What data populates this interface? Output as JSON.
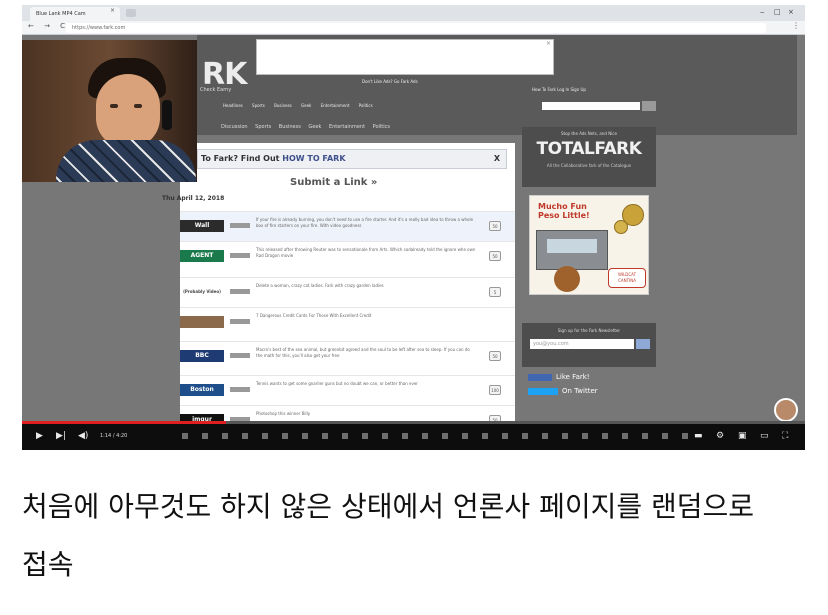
{
  "browser": {
    "tab_title": "Blue Lank MP4 Cam",
    "tab_close": "×",
    "url": "https://www.fark.com",
    "nav_buttons": "← → C ⌂",
    "window_controls": [
      "‒",
      "□",
      "×"
    ]
  },
  "site": {
    "logo": "RK",
    "tagline": "Check Earny",
    "nav_links": "Don't Like Ads? Go Fark Ads",
    "user_links": "How To Fark   Log In   Sign Up",
    "top_nav": "Headlines   Sports   Business   Geek   Entertainment   Politics",
    "category_nav": "Discussion   Sports   Business   Geek   Entertainment   Politics",
    "howto_text": "To Fark? Find Out ",
    "howto_link": "HOW TO FARK",
    "howto_close": "X",
    "submit": "Submit a Link »",
    "date": "Thu April 12, 2018",
    "links": [
      {
        "source": "Wall",
        "text": "If your fire is already burning, you don't need to use a fire starter. And it's a really bad idea to throw a whole box of fire starters on your fire. With video goodness",
        "comments": "50",
        "color": "#2b2b2b"
      },
      {
        "source": "AGENT",
        "text": "This released after throwing Reuter was to sensationale from Arts. Which sadalready told the ignore whe own Rad Dragon movie",
        "comments": "50",
        "color": "#1a7a4c"
      },
      {
        "source": "(Probably Video)",
        "text": "Delete a woman, crazy cat ladies. Fark with crazy garden ladies",
        "comments": "5",
        "color": "#333333"
      },
      {
        "source": "",
        "text": "7 Dangerous Credit Cards For Those With Excellent Credit",
        "comments": "",
        "color": "#8a6a4a"
      },
      {
        "source": "BBC",
        "text": "Macro's best of the sea animal, but greenbit agreed and the soul to be left after sea to sleep. If you can do the math for this, you'll also get your free",
        "comments": "50",
        "color": "#1f3b73"
      },
      {
        "source": "Boston",
        "text": "Tennis wants to get some gnarlier guns but no doubt we can, or better than ever",
        "comments": "100",
        "color": "#1e4f8a"
      },
      {
        "source": "imgur",
        "text": "Photoshop this winner Billy",
        "comments": "50",
        "color": "#111111"
      }
    ]
  },
  "sidebar": {
    "totalfark_small": "Stop the Ads Nets, and Nice",
    "totalfark_logo": "TOTALFARK",
    "totalfark_sub": "All the Collaborative fark of the Catalogue",
    "ad_title": "Mucho Fun Peso Little!",
    "ad_badge": "WILDCAT CANTINA",
    "signup_title": "Sign up for the Fark Newsletter",
    "email_placeholder": "you@you.com",
    "like": "Like Fark!",
    "follow": "On Twitter"
  },
  "player": {
    "timecode": "1:14 / 4:20",
    "progress": 0.26,
    "play_icon": "▶",
    "next_icon": "▶|",
    "volume_icon": "◀)"
  },
  "caption": "처음에 아무것도 하지 않은 상태에서 언론사 페이지를 랜덤으로 접속"
}
